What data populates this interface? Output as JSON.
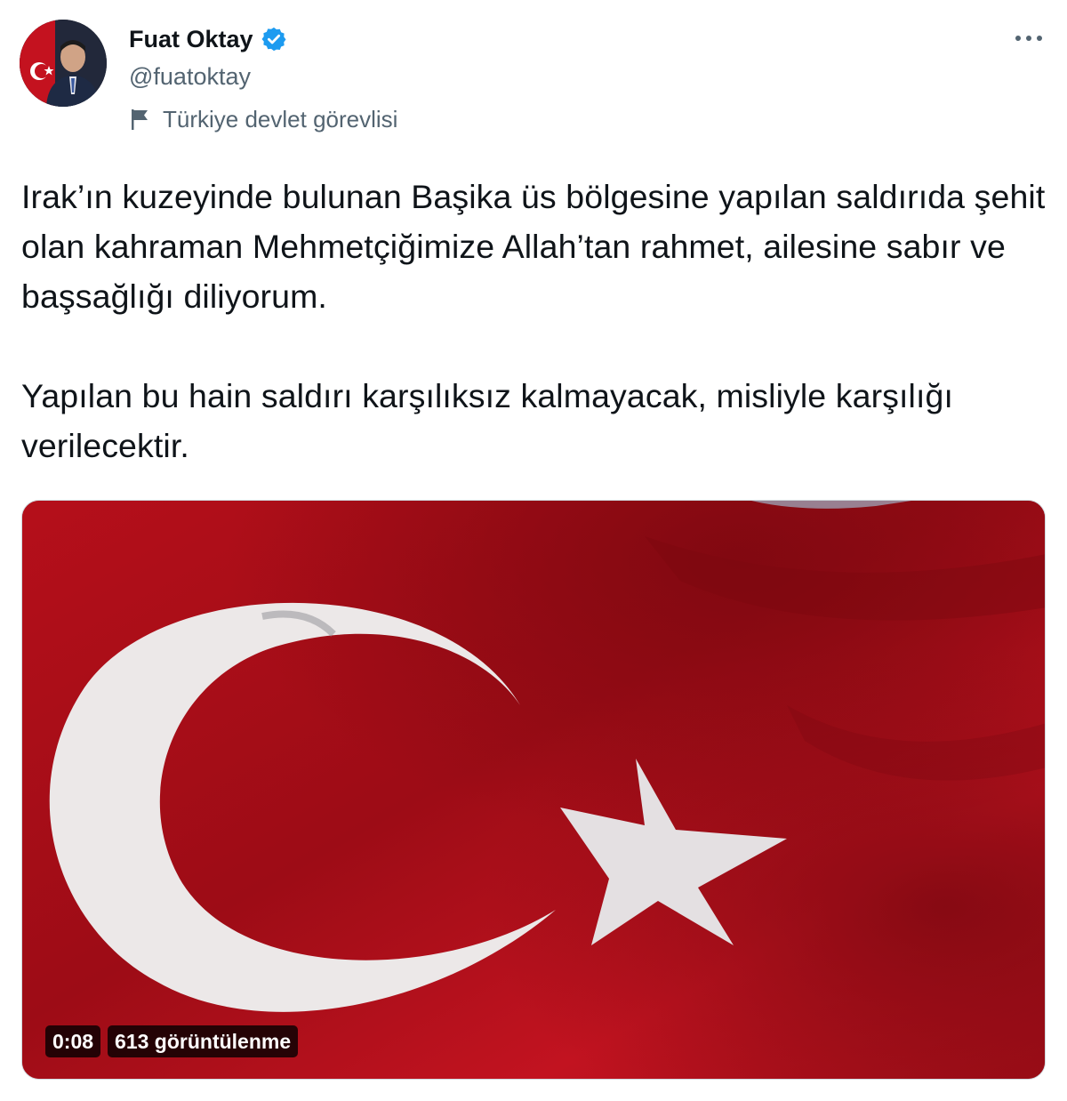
{
  "author": {
    "name": "Fuat Oktay",
    "handle": "@fuatoktay",
    "label": "Türkiye devlet görevlisi",
    "verified": true
  },
  "tweet": {
    "text": "Irak’ın kuzeyinde bulunan Başika üs bölgesine yapılan saldırıda şehit olan kahraman Mehmetçiğimize Allah’tan rahmet, ailesine sabır ve başsağlığı diliyorum.\n\nYapılan bu hain saldırı karşılıksız kalmayacak, misliyle karşılığı verilecektir."
  },
  "video": {
    "duration": "0:08",
    "views": "613 görüntülenme"
  },
  "icons": {
    "verified": "verified-badge-icon",
    "label": "flag-icon",
    "more": "more-dots-icon"
  },
  "colors": {
    "accent": "#1d9bf0",
    "flag_red": "#b8101c",
    "secondary_text": "#536471"
  }
}
